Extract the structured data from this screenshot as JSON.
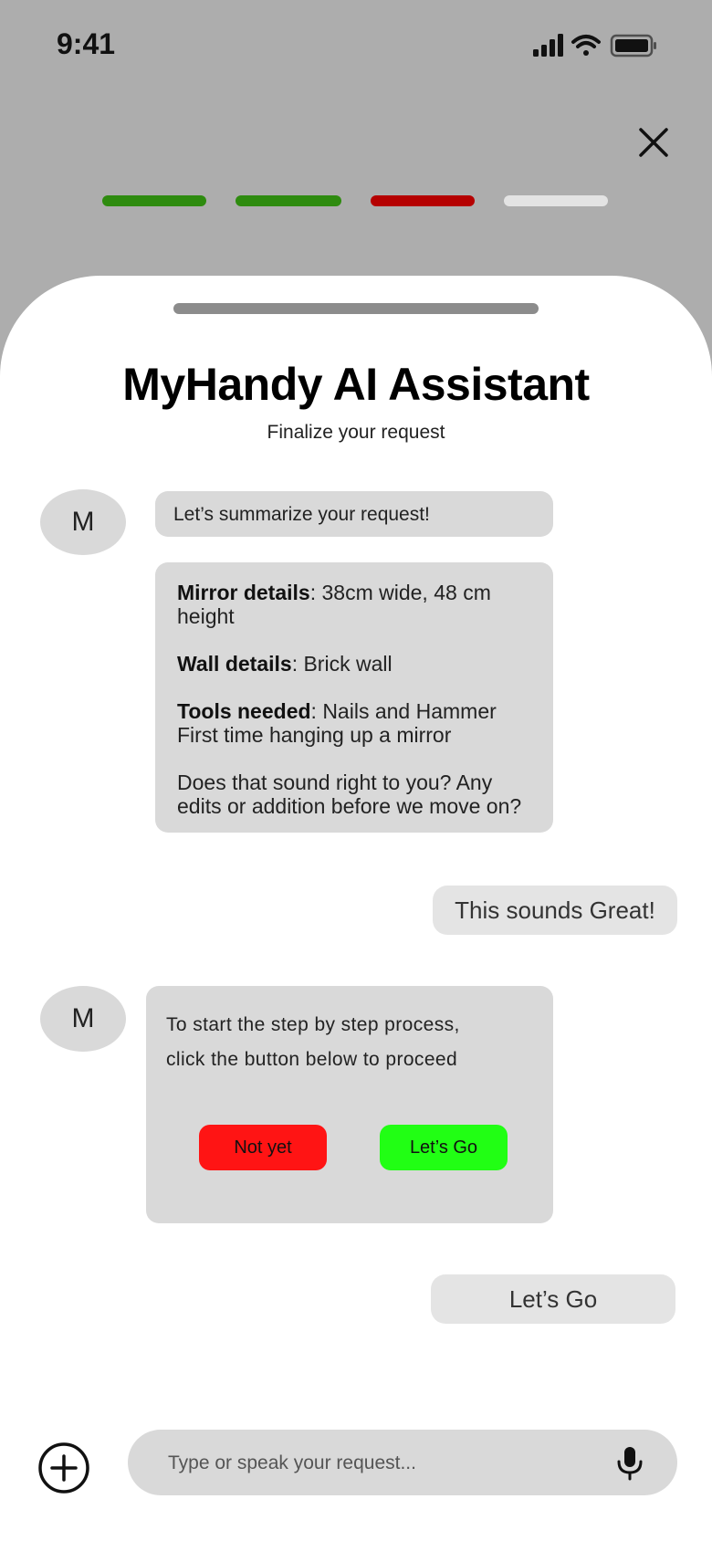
{
  "status": {
    "time": "9:41"
  },
  "progress": {
    "steps": [
      "complete",
      "complete",
      "current",
      "pending"
    ],
    "colors": {
      "complete": "#2e8b0f",
      "current": "#b50000",
      "pending": "#e3e3e3"
    }
  },
  "header": {
    "title": "MyHandy AI Assistant",
    "subtitle": "Finalize your request"
  },
  "assistant": {
    "avatar_letter": "M"
  },
  "messages": {
    "intro": "Let’s summarize your request!",
    "summary": {
      "mirror_label": "Mirror details",
      "mirror_value": ": 38cm wide, 48 cm height",
      "wall_label": "Wall details",
      "wall_value": ": Brick wall",
      "tools_label": "Tools needed",
      "tools_value": ": Nails and Hammer",
      "tools_note": "First time hanging up a mirror",
      "question": "Does that sound right to you? Any edits or addition before we move on?"
    },
    "user_reply_1": "This sounds Great!",
    "action_prompt_line1": "To start the step by step process,",
    "action_prompt_line2": "click the button below to proceed",
    "buttons": {
      "not_yet": "Not yet",
      "lets_go": "Let’s Go"
    },
    "user_reply_2": "Let’s Go"
  },
  "composer": {
    "placeholder": "Type or speak your request..."
  },
  "icons": {
    "close": "close-icon",
    "add": "plus-circle-icon",
    "mic": "microphone-icon",
    "signal": "signal-icon",
    "wifi": "wifi-icon",
    "battery": "battery-icon"
  }
}
